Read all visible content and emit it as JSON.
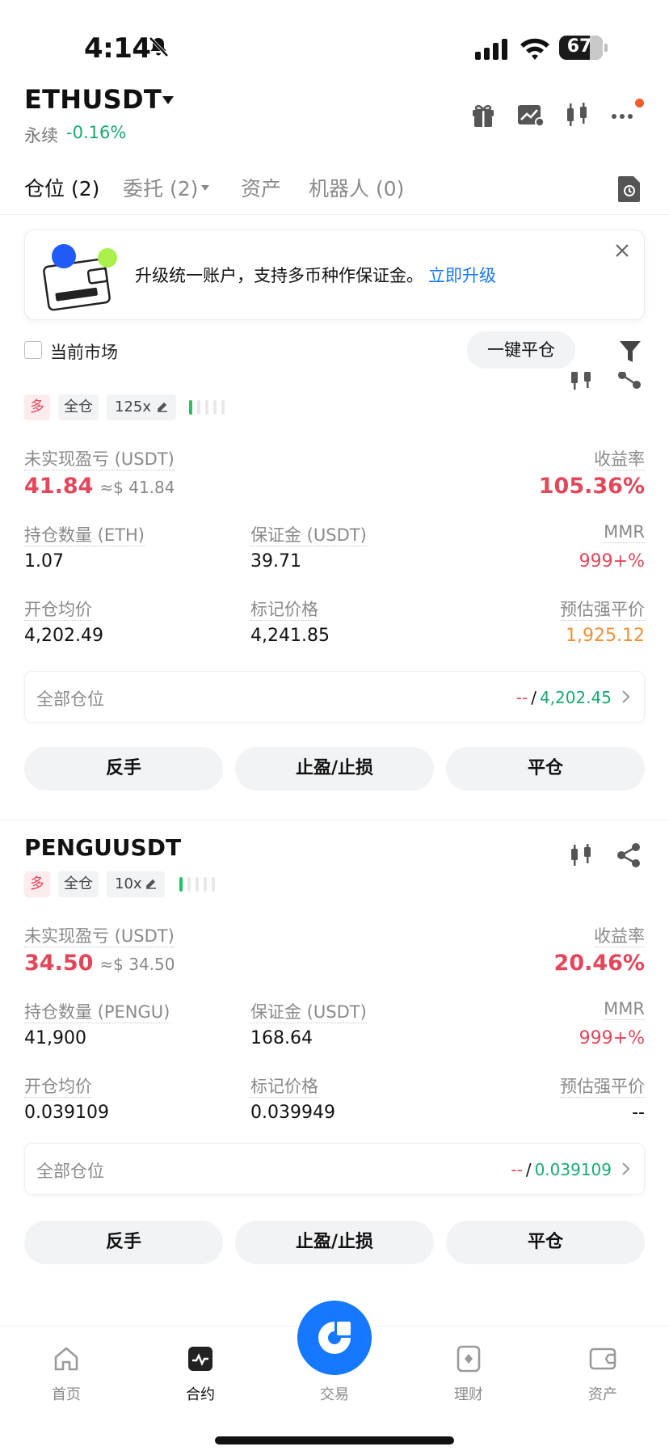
{
  "status_bar": {
    "time": "4:14",
    "battery": "67"
  },
  "header": {
    "symbol": "ETHUSDT",
    "perp_label": "永续",
    "change": "-0.16%"
  },
  "tabs": [
    {
      "label": "仓位 (2)"
    },
    {
      "label": "委托 (2)"
    },
    {
      "label": "资产"
    },
    {
      "label": "机器人 (0)"
    }
  ],
  "banner": {
    "text": "升级统一账户，支持多币种作保证金。",
    "link": "立即升级"
  },
  "filter": {
    "checkbox_label": "当前市场",
    "close_all": "一键平仓"
  },
  "positions": [
    {
      "tag_long": "多",
      "tag_margin": "全仓",
      "leverage": "125x",
      "risk_level": 0.2,
      "pnl_label": "未实现盈亏 (USDT)",
      "pnl": "41.84",
      "pnl_usd": "≈$ 41.84",
      "roe_label": "收益率",
      "roe": "105.36%",
      "qty_label": "持仓数量 (ETH)",
      "qty": "1.07",
      "margin_label": "保证金 (USDT)",
      "margin": "39.71",
      "mmr_label": "MMR",
      "mmr": "999+%",
      "entry_label": "开仓均价",
      "entry": "4,202.49",
      "mark_label": "标记价格",
      "mark": "4,241.85",
      "liq_label": "预估强平价",
      "liq": "1,925.12",
      "all_label": "全部仓位",
      "all_left": "--",
      "all_sep": "/",
      "all_right": "4,202.45"
    },
    {
      "symbol": "PENGUUSDT",
      "tag_long": "多",
      "tag_margin": "全仓",
      "leverage": "10x",
      "risk_level": 0.2,
      "pnl_label": "未实现盈亏 (USDT)",
      "pnl": "34.50",
      "pnl_usd": "≈$ 34.50",
      "roe_label": "收益率",
      "roe": "20.46%",
      "qty_label": "持仓数量 (PENGU)",
      "qty": "41,900",
      "margin_label": "保证金 (USDT)",
      "margin": "168.64",
      "mmr_label": "MMR",
      "mmr": "999+%",
      "entry_label": "开仓均价",
      "entry": "0.039109",
      "mark_label": "标记价格",
      "mark": "0.039949",
      "liq_label": "预估强平价",
      "liq": "--",
      "all_label": "全部仓位",
      "all_left": "--",
      "all_sep": "/",
      "all_right": "0.039109"
    }
  ],
  "actions": {
    "reverse": "反手",
    "tpsl": "止盈/止损",
    "close": "平仓"
  },
  "bottom_nav": {
    "home": "首页",
    "futures": "合约",
    "trade": "交易",
    "earn": "理财",
    "assets": "资产"
  },
  "colors": {
    "accent": "#1677ff",
    "loss_red": "#e2475a",
    "gain_green": "#1aa971",
    "liq_orange": "#f0903a"
  }
}
